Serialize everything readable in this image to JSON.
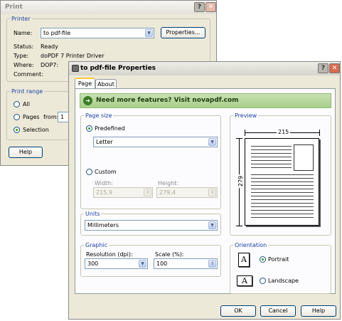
{
  "print_dialog": {
    "title": "Print",
    "printer_group": "Printer",
    "name_label": "Name:",
    "name_value": "to pdf-file",
    "properties_button": "Properties...",
    "status_label": "Status:",
    "status_value": "Ready",
    "type_label": "Type:",
    "type_value": "doPDF 7 Printer Driver",
    "where_label": "Where:",
    "where_value": "DOP7:",
    "comment_label": "Comment:",
    "range_group": "Print range",
    "range_all": "All",
    "range_pages": "Pages",
    "from_label": "from:",
    "from_value": "1",
    "range_selection": "Selection",
    "range_selected": "Selection",
    "help_button": "Help"
  },
  "props_dialog": {
    "title": "to pdf-file Properties",
    "tabs": [
      {
        "label": "Page",
        "selected": true
      },
      {
        "label": "About",
        "selected": false
      }
    ],
    "banner_text": "Need more features? Visit novapdf.com",
    "page_size": {
      "group": "Page size",
      "predefined_label": "Predefined",
      "predefined_selected": true,
      "size_value": "Letter",
      "custom_label": "Custom",
      "width_label": "Width:",
      "width_value": "215,9",
      "height_label": "Height:",
      "height_value": "279,4"
    },
    "preview": {
      "group": "Preview",
      "width_dim": "215",
      "height_dim": "279"
    },
    "units": {
      "group": "Units",
      "value": "Millimeters"
    },
    "graphic": {
      "group": "Graphic",
      "resolution_label": "Resolution (dpi):",
      "resolution_value": "300",
      "scale_label": "Scale (%):",
      "scale_value": "100"
    },
    "orientation": {
      "group": "Orientation",
      "portrait_label": "Portrait",
      "landscape_label": "Landscape",
      "selected": "Portrait",
      "icon_letter": "A"
    },
    "ok_button": "OK",
    "cancel_button": "Cancel",
    "help_button": "Help"
  }
}
